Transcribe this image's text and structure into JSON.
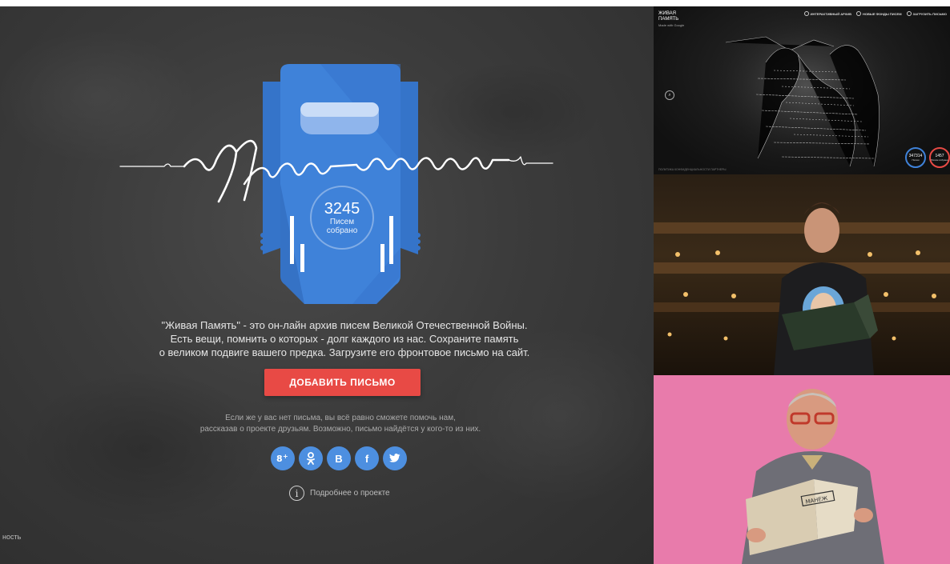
{
  "main": {
    "logo_alt": "Живая память",
    "counter": {
      "value": "3245",
      "label_line1": "Писем",
      "label_line2": "собрано"
    },
    "description": {
      "line1": "\"Живая Память\" - это он-лайн архив писем Великой Отечественной Войны.",
      "line2": "Есть вещи, помнить о которых - долг каждого из нас. Сохраните память",
      "line3": "о великом подвиге вашего предка. Загрузите его фронтовое письмо на сайт."
    },
    "add_button_label": "ДОБАВИТЬ ПИСЬМО",
    "help": {
      "line1": "Если же у вас нет письма, вы всё равно сможете помочь нам,",
      "line2": "рассказав о проекте друзьям. Возможно, письмо найдётся у кого-то из них."
    },
    "social": [
      {
        "name": "google-plus",
        "glyph": "8⁺"
      },
      {
        "name": "odnoklassniki",
        "glyph": "ок"
      },
      {
        "name": "vkontakte",
        "glyph": "B"
      },
      {
        "name": "facebook",
        "glyph": "f"
      },
      {
        "name": "twitter",
        "glyph": "t"
      }
    ],
    "more_label": "Подробнее о проекте",
    "corner_text": "ность",
    "colors": {
      "accent_blue": "#3f82d9",
      "button_red": "#e84a45"
    }
  },
  "preview_top": {
    "logo_line1": "ЖИВАЯ",
    "logo_line2": "ПАМЯТЬ",
    "powered": "Made with Google",
    "nav": [
      "ИНТЕРАКТИВНЫЙ АРХИВ",
      "НОВЫЕ ФОНДЫ ПИСЕМ",
      "ЗАГРУЗИТЬ ПИСЬМО"
    ],
    "stat_blue": {
      "value": "347314",
      "label": "Писем"
    },
    "stat_red": {
      "value": "1457",
      "label": "Писем собрано"
    },
    "bottom_text": "ПОЛИТИКА КОНФИДЕНЦИАЛЬНОСТИ  ПАРТНЕРЫ"
  },
  "preview_bot": {
    "folder_label": "МАНЕЖ"
  }
}
